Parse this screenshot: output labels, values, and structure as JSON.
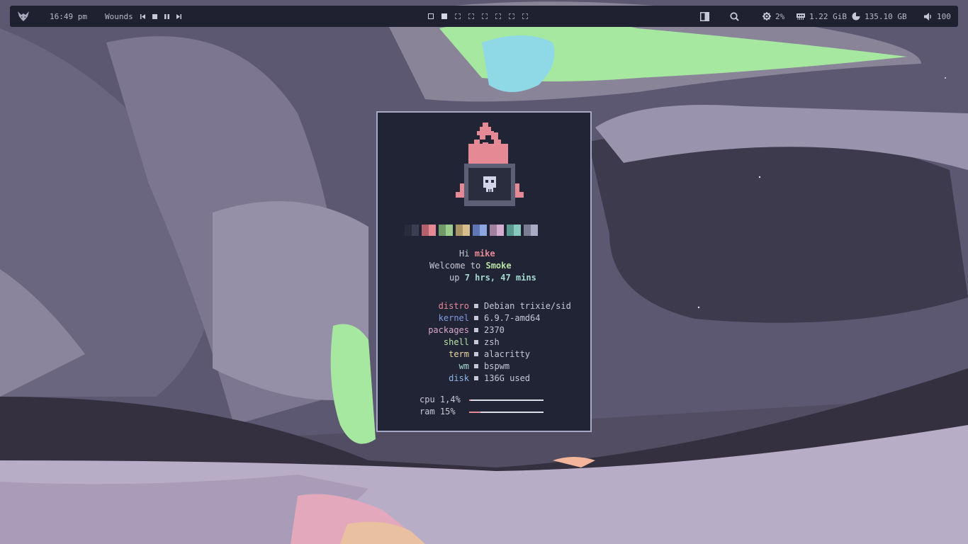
{
  "topbar": {
    "clock": "16:49 pm",
    "music": {
      "title": "Wounds",
      "prev_icon": "skip-back-icon",
      "stop_icon": "stop-icon",
      "pause_icon": "pause-icon",
      "next_icon": "skip-forward-icon"
    },
    "workspaces": [
      "active",
      "occupied",
      "empty",
      "empty",
      "empty",
      "empty",
      "empty",
      "empty"
    ],
    "cpu": "2%",
    "memory": "1.22 GiB",
    "disk": "135.10 GB",
    "volume": "100"
  },
  "fetch": {
    "greeting_prefix": "Hi ",
    "user": "mike",
    "welcome_prefix": "Welcome to ",
    "distro_name": "Smoke",
    "uptime_prefix": "up ",
    "uptime": "7 hrs, 47 mins",
    "info": [
      {
        "key": "distro",
        "value": "Debian trixie/sid",
        "color": "#e58a95"
      },
      {
        "key": "kernel",
        "value": "6.9.7-amd64",
        "color": "#7e9be0"
      },
      {
        "key": "packages",
        "value": "2370",
        "color": "#d8a7c8"
      },
      {
        "key": "shell",
        "value": "zsh",
        "color": "#b6e3a4"
      },
      {
        "key": "term",
        "value": "alacritty",
        "color": "#e8d8a0"
      },
      {
        "key": "wm",
        "value": "bspwm",
        "color": "#a3d9d0"
      },
      {
        "key": "disk",
        "value": "136G used",
        "color": "#8fb4e8"
      }
    ],
    "meters": [
      {
        "label": "cpu 1,4%",
        "fraction": 0.014
      },
      {
        "label": "ram 15%",
        "fraction": 0.15
      }
    ],
    "palette": [
      [
        "#2a2c3c",
        "#3b3e52"
      ],
      [
        "#b45f6c",
        "#e58a95"
      ],
      [
        "#6f9a68",
        "#9ccc8c"
      ],
      [
        "#a99466",
        "#d6bf8c"
      ],
      [
        "#5e76b4",
        "#8ea6e0"
      ],
      [
        "#a0809e",
        "#d3aed0"
      ],
      [
        "#5a9990",
        "#88c9be"
      ],
      [
        "#7a7c92",
        "#a9abc4"
      ]
    ]
  },
  "colors": {
    "bar_bg": "#1f2130",
    "window_bg": "#212434",
    "window_border": "#a7a9c7",
    "accent_pink": "#e58a95"
  }
}
